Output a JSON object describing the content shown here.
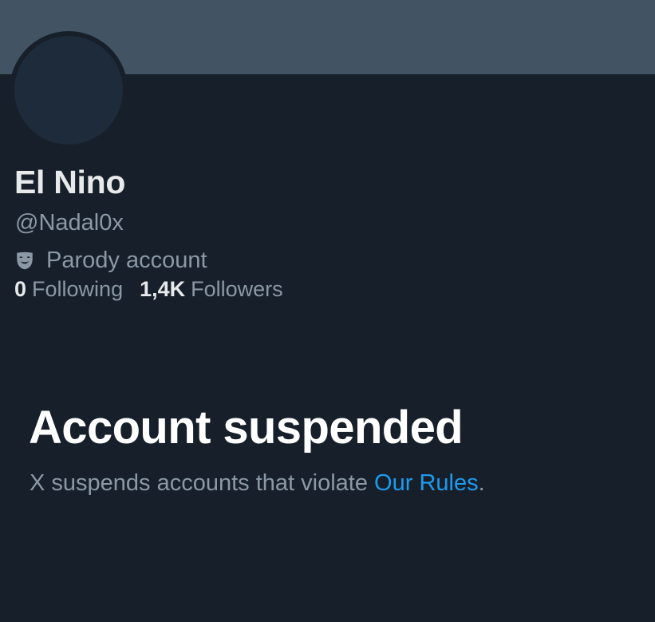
{
  "profile": {
    "display_name": "El Nino",
    "handle": "@Nadal0x",
    "parody_label": "Parody account",
    "parody_icon": "parody-mask-icon"
  },
  "stats": {
    "following_value": "0",
    "following_label": "Following",
    "followers_value": "1,4K",
    "followers_label": "Followers"
  },
  "notice": {
    "title": "Account suspended",
    "description_prefix": "X suspends accounts that violate ",
    "rules_link": "Our Rules",
    "description_suffix": "."
  },
  "colors": {
    "banner": "#425364",
    "background": "#17202a",
    "primary_text": "#e7e9ea",
    "secondary_text": "#8b98a5",
    "link": "#1d9bf0"
  }
}
